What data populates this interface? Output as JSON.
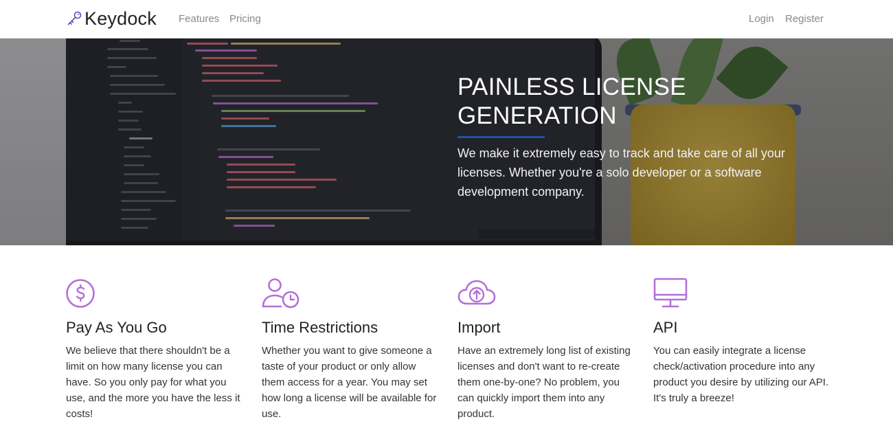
{
  "nav": {
    "brand": "Keydock",
    "links": [
      "Features",
      "Pricing"
    ],
    "login": "Login",
    "register": "Register"
  },
  "hero": {
    "title_line1": "PAINLESS LICENSE",
    "title_line2": "GENERATION",
    "text": "We make it extremely easy to track and take care of all your licenses. Whether you're a solo developer or a software development company."
  },
  "features": [
    {
      "icon": "dollar-circle-icon",
      "title": "Pay As You Go",
      "text": "We believe that there shouldn't be a limit on how many license you can have. So you only pay for what you use, and the more you have the less it costs!"
    },
    {
      "icon": "user-clock-icon",
      "title": "Time Restrictions",
      "text": "Whether you want to give someone a taste of your product or only allow them access for a year. You may set how long a license will be available for use."
    },
    {
      "icon": "cloud-upload-icon",
      "title": "Import",
      "text": "Have an extremely long list of existing licenses and don't want to re-create them one-by-one? No problem, you can quickly import them into any product."
    },
    {
      "icon": "monitor-icon",
      "title": "API",
      "text": "You can easily integrate a license check/activation procedure into any product you desire by utilizing our API. It's truly a breeze!"
    }
  ],
  "colors": {
    "accent": "#b36fd8",
    "hero_rule": "#2150a8"
  }
}
